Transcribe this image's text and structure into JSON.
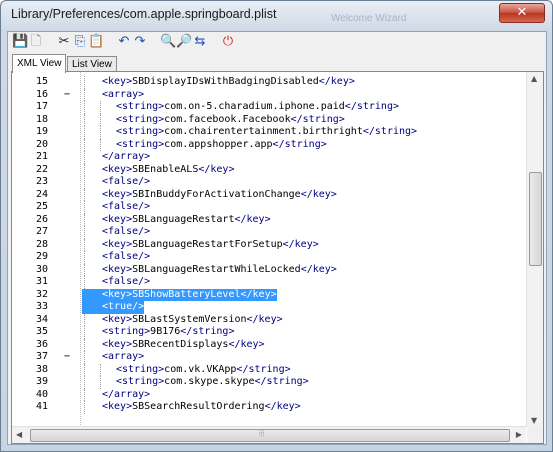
{
  "window": {
    "title": "Library/Preferences/com.apple.springboard.plist",
    "background_ghost_text": "Welcome Wizard",
    "close_glyph": "✕"
  },
  "toolbar": {
    "icons": [
      {
        "name": "save-icon",
        "glyph": "💾",
        "color": "#1f4fa8"
      },
      {
        "name": "new-document-icon",
        "glyph": "🗋",
        "color": "#7a8aa0"
      },
      {
        "name": "cut-icon",
        "glyph": "✂",
        "color": "#222222"
      },
      {
        "name": "copy-icon",
        "glyph": "⎘",
        "color": "#2a5aa8"
      },
      {
        "name": "paste-icon",
        "glyph": "📋",
        "color": "#8a6a2a"
      },
      {
        "name": "undo-icon",
        "glyph": "↶",
        "color": "#1c4fb5"
      },
      {
        "name": "redo-icon",
        "glyph": "↷",
        "color": "#1c4fb5"
      },
      {
        "name": "find-icon",
        "glyph": "🔍",
        "color": "#222222"
      },
      {
        "name": "find-next-icon",
        "glyph": "🔎",
        "color": "#1c4fb5"
      },
      {
        "name": "replace-icon",
        "glyph": "⇆",
        "color": "#1c4fb5"
      },
      {
        "name": "power-icon",
        "glyph": "⏻",
        "color": "#e02020"
      }
    ]
  },
  "tabs": [
    {
      "label": "XML View",
      "active": true
    },
    {
      "label": "List View",
      "active": false
    }
  ],
  "editor": {
    "lines": [
      {
        "num": "15",
        "fold": "",
        "indent": 1,
        "parts": [
          {
            "k": "t",
            "v": "<key>"
          },
          {
            "k": "txt",
            "v": "SBDisplayIDsWithBadgingDisabled"
          },
          {
            "k": "t",
            "v": "</key>"
          }
        ]
      },
      {
        "num": "16",
        "fold": "−",
        "indent": 1,
        "parts": [
          {
            "k": "t",
            "v": "<array>"
          }
        ]
      },
      {
        "num": "17",
        "fold": "",
        "indent": 2,
        "parts": [
          {
            "k": "t",
            "v": "<string>"
          },
          {
            "k": "txt",
            "v": "com.on-5.charadium.iphone.paid"
          },
          {
            "k": "t",
            "v": "</string>"
          }
        ]
      },
      {
        "num": "18",
        "fold": "",
        "indent": 2,
        "parts": [
          {
            "k": "t",
            "v": "<string>"
          },
          {
            "k": "txt",
            "v": "com.facebook.Facebook"
          },
          {
            "k": "t",
            "v": "</string>"
          }
        ]
      },
      {
        "num": "19",
        "fold": "",
        "indent": 2,
        "parts": [
          {
            "k": "t",
            "v": "<string>"
          },
          {
            "k": "txt",
            "v": "com.chairentertainment.birthright"
          },
          {
            "k": "t",
            "v": "</string>"
          }
        ]
      },
      {
        "num": "20",
        "fold": "",
        "indent": 2,
        "parts": [
          {
            "k": "t",
            "v": "<string>"
          },
          {
            "k": "txt",
            "v": "com.appshopper.app"
          },
          {
            "k": "t",
            "v": "</string>"
          }
        ]
      },
      {
        "num": "21",
        "fold": "",
        "indent": 1,
        "parts": [
          {
            "k": "t",
            "v": "</array>"
          }
        ]
      },
      {
        "num": "22",
        "fold": "",
        "indent": 1,
        "parts": [
          {
            "k": "t",
            "v": "<key>"
          },
          {
            "k": "txt",
            "v": "SBEnableALS"
          },
          {
            "k": "t",
            "v": "</key>"
          }
        ]
      },
      {
        "num": "23",
        "fold": "",
        "indent": 1,
        "parts": [
          {
            "k": "t",
            "v": "<false/>"
          }
        ]
      },
      {
        "num": "24",
        "fold": "",
        "indent": 1,
        "parts": [
          {
            "k": "t",
            "v": "<key>"
          },
          {
            "k": "txt",
            "v": "SBInBuddyForActivationChange"
          },
          {
            "k": "t",
            "v": "</key>"
          }
        ]
      },
      {
        "num": "25",
        "fold": "",
        "indent": 1,
        "parts": [
          {
            "k": "t",
            "v": "<false/>"
          }
        ]
      },
      {
        "num": "26",
        "fold": "",
        "indent": 1,
        "parts": [
          {
            "k": "t",
            "v": "<key>"
          },
          {
            "k": "txt",
            "v": "SBLanguageRestart"
          },
          {
            "k": "t",
            "v": "</key>"
          }
        ]
      },
      {
        "num": "27",
        "fold": "",
        "indent": 1,
        "parts": [
          {
            "k": "t",
            "v": "<false/>"
          }
        ]
      },
      {
        "num": "28",
        "fold": "",
        "indent": 1,
        "parts": [
          {
            "k": "t",
            "v": "<key>"
          },
          {
            "k": "txt",
            "v": "SBLanguageRestartForSetup"
          },
          {
            "k": "t",
            "v": "</key>"
          }
        ]
      },
      {
        "num": "29",
        "fold": "",
        "indent": 1,
        "parts": [
          {
            "k": "t",
            "v": "<false/>"
          }
        ]
      },
      {
        "num": "30",
        "fold": "",
        "indent": 1,
        "parts": [
          {
            "k": "t",
            "v": "<key>"
          },
          {
            "k": "txt",
            "v": "SBLanguageRestartWhileLocked"
          },
          {
            "k": "t",
            "v": "</key>"
          }
        ]
      },
      {
        "num": "31",
        "fold": "",
        "indent": 1,
        "parts": [
          {
            "k": "t",
            "v": "<false/>"
          }
        ]
      },
      {
        "num": "32",
        "fold": "",
        "indent": 1,
        "selected": true,
        "parts": [
          {
            "k": "t",
            "v": "<key>"
          },
          {
            "k": "txt",
            "v": "SBShowBatteryLevel"
          },
          {
            "k": "t",
            "v": "</key>"
          }
        ]
      },
      {
        "num": "33",
        "fold": "",
        "indent": 1,
        "selected": true,
        "parts": [
          {
            "k": "t",
            "v": "<true/>"
          }
        ]
      },
      {
        "num": "34",
        "fold": "",
        "indent": 1,
        "parts": [
          {
            "k": "t",
            "v": "<key>"
          },
          {
            "k": "txt",
            "v": "SBLastSystemVersion"
          },
          {
            "k": "t",
            "v": "</key>"
          }
        ]
      },
      {
        "num": "35",
        "fold": "",
        "indent": 1,
        "parts": [
          {
            "k": "t",
            "v": "<string>"
          },
          {
            "k": "txt",
            "v": "9B176"
          },
          {
            "k": "t",
            "v": "</string>"
          }
        ]
      },
      {
        "num": "36",
        "fold": "",
        "indent": 1,
        "parts": [
          {
            "k": "t",
            "v": "<key>"
          },
          {
            "k": "txt",
            "v": "SBRecentDisplays"
          },
          {
            "k": "t",
            "v": "</key>"
          }
        ]
      },
      {
        "num": "37",
        "fold": "−",
        "indent": 1,
        "parts": [
          {
            "k": "t",
            "v": "<array>"
          }
        ]
      },
      {
        "num": "38",
        "fold": "",
        "indent": 2,
        "parts": [
          {
            "k": "t",
            "v": "<string>"
          },
          {
            "k": "txt",
            "v": "com.vk.VKApp"
          },
          {
            "k": "t",
            "v": "</string>"
          }
        ]
      },
      {
        "num": "39",
        "fold": "",
        "indent": 2,
        "parts": [
          {
            "k": "t",
            "v": "<string>"
          },
          {
            "k": "txt",
            "v": "com.skype.skype"
          },
          {
            "k": "t",
            "v": "</string>"
          }
        ]
      },
      {
        "num": "40",
        "fold": "",
        "indent": 1,
        "parts": [
          {
            "k": "t",
            "v": "</array>"
          }
        ]
      },
      {
        "num": "41",
        "fold": "",
        "indent": 1,
        "parts": [
          {
            "k": "t",
            "v": "<key>"
          },
          {
            "k": "txt",
            "v": "SBSearchResultOrdering"
          },
          {
            "k": "t",
            "v": "</key>"
          }
        ]
      }
    ]
  },
  "scrollbars": {
    "vertical_up": "▲",
    "vertical_down": "▼",
    "horizontal_left": "◀",
    "horizontal_right": "▶",
    "grip": "⦙⦙⦙"
  },
  "colors": {
    "tag": "#000080",
    "text": "#000000",
    "selection": "#3399ff"
  }
}
